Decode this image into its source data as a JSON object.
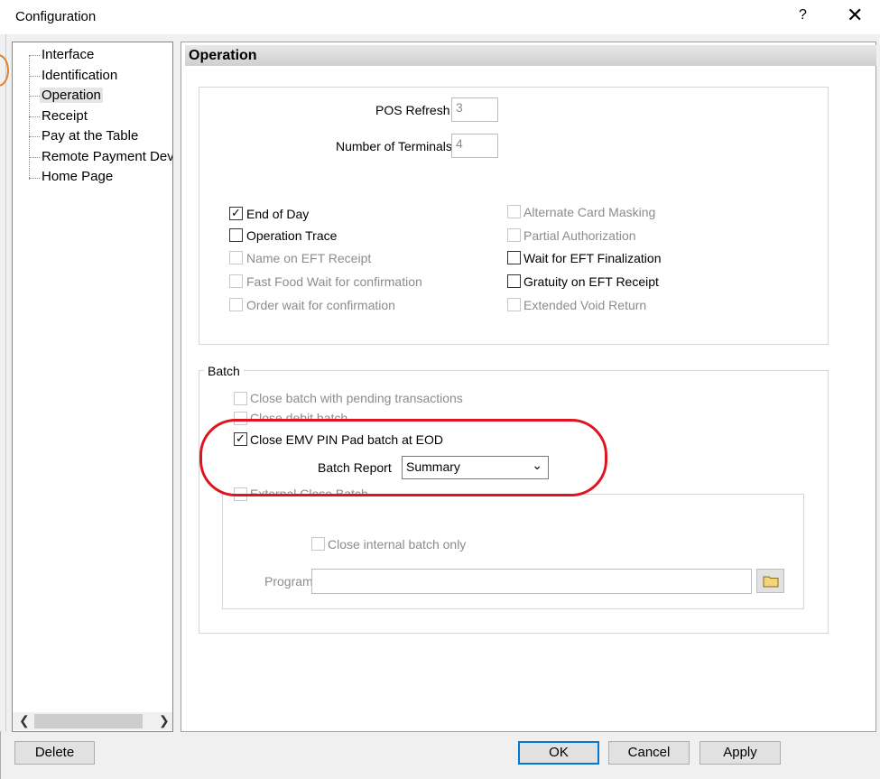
{
  "window": {
    "title": "Configuration",
    "help_label": "?",
    "close_label": "✕"
  },
  "tree": {
    "items": [
      "Interface",
      "Identification",
      "Operation",
      "Receipt",
      "Pay at the Table",
      "Remote Payment Devi",
      "Home Page"
    ],
    "selected": "Operation"
  },
  "panel": {
    "heading": "Operation"
  },
  "operation": {
    "pos_refresh_label": "POS Refresh",
    "pos_refresh_value": "3",
    "terminals_label": "Number of Terminals",
    "terminals_value": "4",
    "left_options": [
      {
        "label": "End of Day",
        "checked": "✓"
      },
      {
        "label": "Operation Trace",
        "checked": ""
      },
      {
        "label": "Name on EFT Receipt",
        "checked": ""
      },
      {
        "label": "Fast Food Wait for confirmation",
        "checked": ""
      },
      {
        "label": "Order wait for confirmation",
        "checked": ""
      }
    ],
    "right_options": [
      {
        "label": "Alternate Card Masking",
        "checked": ""
      },
      {
        "label": "Partial Authorization",
        "checked": ""
      },
      {
        "label": "Wait for EFT Finalization",
        "checked": ""
      },
      {
        "label": "Gratuity on EFT Receipt",
        "checked": ""
      },
      {
        "label": "Extended Void Return",
        "checked": ""
      }
    ]
  },
  "batch": {
    "group_label": "Batch",
    "pending_label": "Close batch with pending transactions",
    "debit_label": "Close debit batch",
    "emv_label": "Close EMV PIN Pad batch at EOD",
    "emv_checked": "✓",
    "report_label": "Batch Report",
    "report_value": "Summary",
    "external_label": "External Close Batch",
    "internal_label": "Close internal batch only",
    "program_label": "Program",
    "program_value": ""
  },
  "footer": {
    "delete_label": "Delete",
    "ok_label": "OK",
    "cancel_label": "Cancel",
    "apply_label": "Apply"
  },
  "colors": {
    "highlight_ring": "#e0141e",
    "default_button_border": "#0078d7"
  }
}
